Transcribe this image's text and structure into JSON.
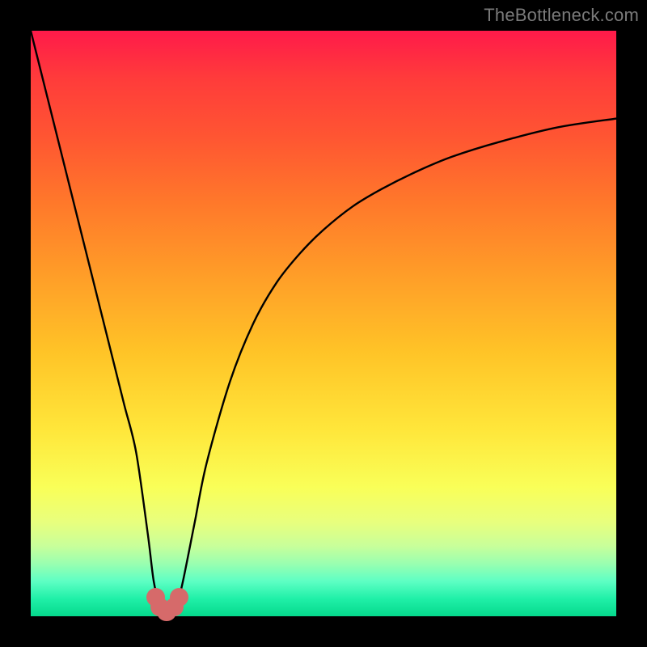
{
  "watermark": "TheBottleneck.com",
  "colors": {
    "frame": "#000000",
    "watermark": "#7a7a7a",
    "curve": "#000000",
    "marker": "#d66a6a"
  },
  "chart_data": {
    "type": "line",
    "title": "",
    "xlabel": "",
    "ylabel": "",
    "xlim": [
      0,
      100
    ],
    "ylim": [
      0,
      100
    ],
    "grid": false,
    "legend": false,
    "series": [
      {
        "name": "bottleneck-curve",
        "x": [
          0,
          2,
          4,
          6,
          8,
          10,
          12,
          14,
          16,
          18,
          20,
          21,
          22,
          23,
          24,
          25,
          26,
          28,
          30,
          34,
          38,
          42,
          46,
          50,
          55,
          60,
          66,
          72,
          80,
          90,
          100
        ],
        "y": [
          100,
          92,
          84,
          76,
          68,
          60,
          52,
          44,
          36,
          28,
          14,
          6,
          2,
          0,
          0,
          2,
          6,
          16,
          26,
          40,
          50,
          57,
          62,
          66,
          70,
          73,
          76,
          78.5,
          81,
          83.5,
          85
        ]
      }
    ],
    "markers": [
      {
        "x": 21.3,
        "y": 3.2
      },
      {
        "x": 22.0,
        "y": 1.6
      },
      {
        "x": 23.2,
        "y": 0.8
      },
      {
        "x": 24.5,
        "y": 1.6
      },
      {
        "x": 25.3,
        "y": 3.2
      }
    ],
    "marker_radius_pct": 1.6,
    "gradient_stops": [
      {
        "pos": 0,
        "color": "#ff1a4a"
      },
      {
        "pos": 8,
        "color": "#ff3b3b"
      },
      {
        "pos": 18,
        "color": "#ff5532"
      },
      {
        "pos": 30,
        "color": "#ff7a2a"
      },
      {
        "pos": 42,
        "color": "#ff9e28"
      },
      {
        "pos": 55,
        "color": "#ffc427"
      },
      {
        "pos": 68,
        "color": "#ffe63a"
      },
      {
        "pos": 78,
        "color": "#f9ff58"
      },
      {
        "pos": 84,
        "color": "#e8ff7e"
      },
      {
        "pos": 88,
        "color": "#c8ff9a"
      },
      {
        "pos": 91,
        "color": "#9affb0"
      },
      {
        "pos": 94,
        "color": "#5effc4"
      },
      {
        "pos": 97,
        "color": "#20f0a8"
      },
      {
        "pos": 100,
        "color": "#05d98c"
      }
    ]
  }
}
